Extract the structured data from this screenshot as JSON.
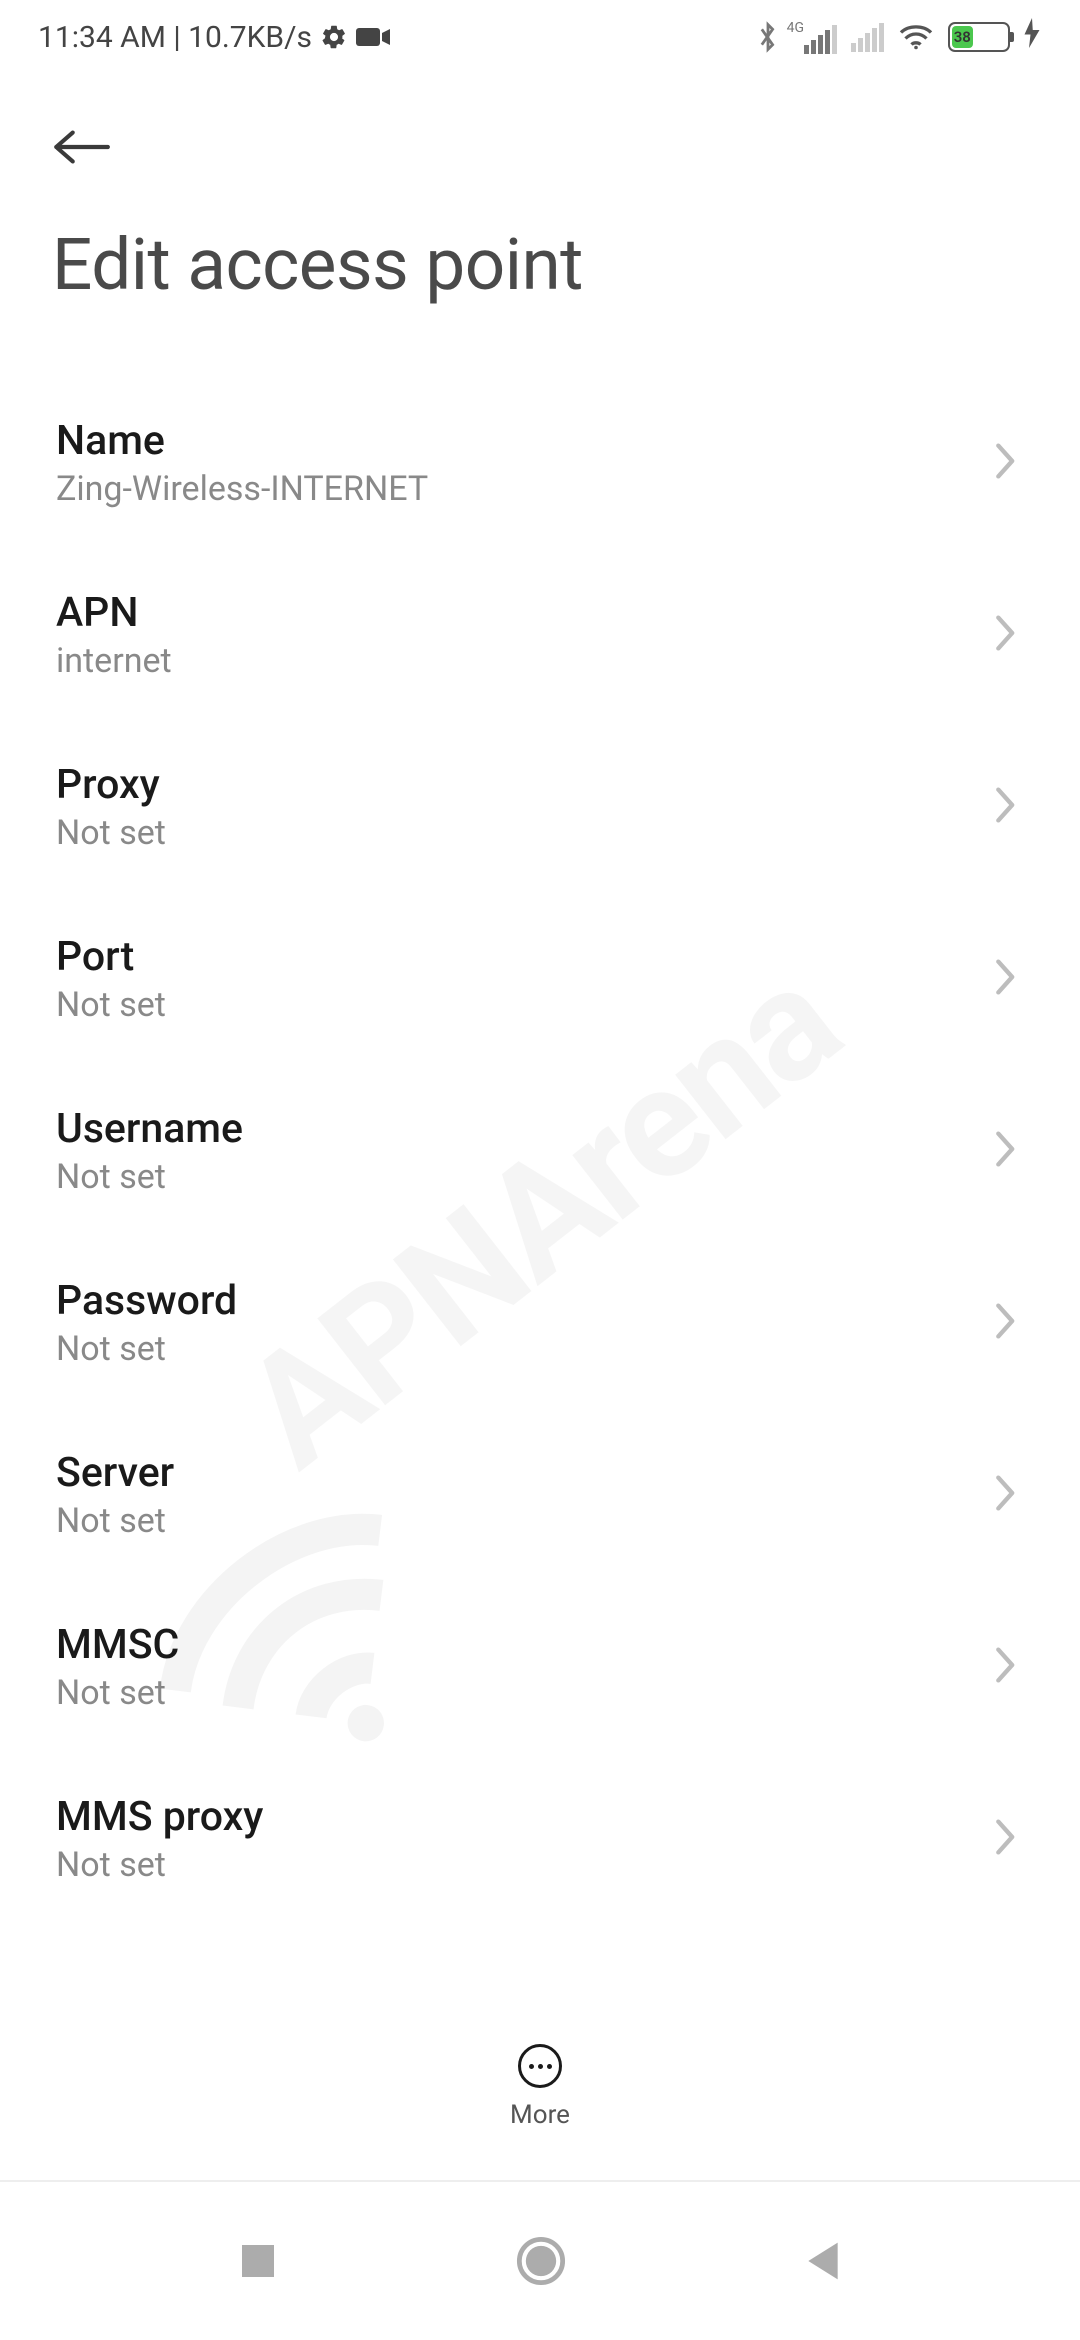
{
  "status": {
    "time_text": "11:34 AM | 10.7KB/s",
    "network_label": "4G",
    "battery_percent": "38",
    "battery_width_pct": 38
  },
  "page": {
    "title": "Edit access point"
  },
  "items": [
    {
      "label": "Name",
      "value": "Zing-Wireless-INTERNET",
      "name": "field-name"
    },
    {
      "label": "APN",
      "value": "internet",
      "name": "field-apn"
    },
    {
      "label": "Proxy",
      "value": "Not set",
      "name": "field-proxy"
    },
    {
      "label": "Port",
      "value": "Not set",
      "name": "field-port"
    },
    {
      "label": "Username",
      "value": "Not set",
      "name": "field-username"
    },
    {
      "label": "Password",
      "value": "Not set",
      "name": "field-password"
    },
    {
      "label": "Server",
      "value": "Not set",
      "name": "field-server"
    },
    {
      "label": "MMSC",
      "value": "Not set",
      "name": "field-mmsc"
    },
    {
      "label": "MMS proxy",
      "value": "Not set",
      "name": "field-mms-proxy"
    }
  ],
  "bottom": {
    "more_label": "More"
  },
  "watermark": "APNArena"
}
